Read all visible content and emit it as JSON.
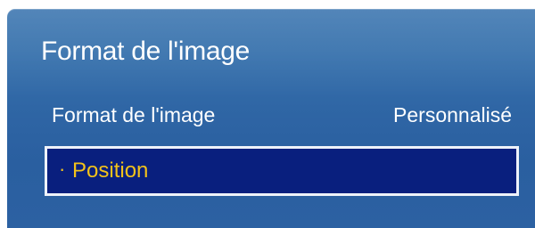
{
  "menu": {
    "title": "Format de l'image",
    "items": [
      {
        "label": "Format de l'image",
        "value": "Personnalisé"
      },
      {
        "bullet": "·",
        "label": "Position"
      }
    ]
  },
  "colors": {
    "panel": "#3070ad",
    "selected_bg": "#091f7e",
    "selected_text": "#f2c21a",
    "text": "#ffffff"
  }
}
